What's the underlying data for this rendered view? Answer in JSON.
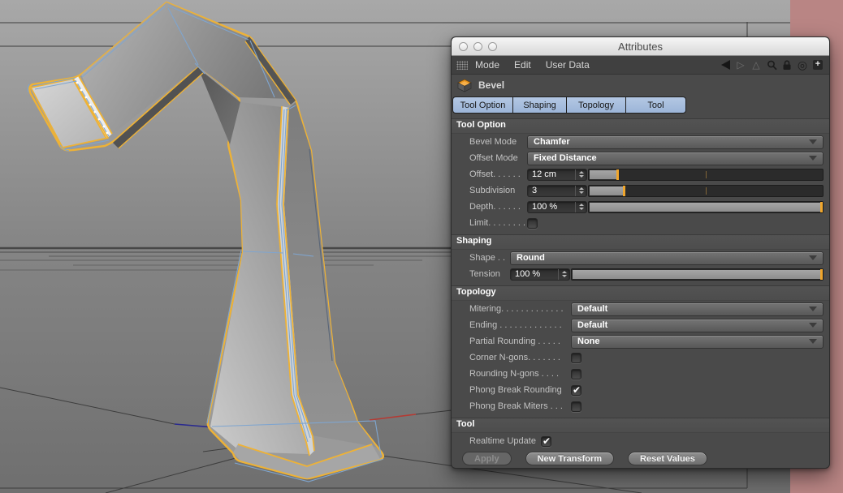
{
  "window": {
    "title": "Attributes"
  },
  "menubar": {
    "items": [
      "Mode",
      "Edit",
      "User Data"
    ],
    "plus_glyph": "+"
  },
  "object_header": {
    "label": "Bevel"
  },
  "tabs": [
    {
      "label": "Tool Option"
    },
    {
      "label": "Shaping"
    },
    {
      "label": "Topology"
    },
    {
      "label": "Tool"
    }
  ],
  "tool_option": {
    "title": "Tool Option",
    "bevel_mode": {
      "label": "Bevel Mode",
      "value": "Chamfer"
    },
    "offset_mode": {
      "label": "Offset Mode",
      "value": "Fixed Distance"
    },
    "offset": {
      "label": "Offset. . . . . .",
      "value": "12 cm",
      "slider_pct": 12
    },
    "subdivision": {
      "label": "Subdivision",
      "value": "3",
      "slider_pct": 15
    },
    "depth": {
      "label": "Depth. . . . . .",
      "value": "100 %",
      "slider_pct": 100
    },
    "limit": {
      "label": "Limit. . . . . . . .",
      "checked": false
    }
  },
  "shaping": {
    "title": "Shaping",
    "shape": {
      "label": "Shape . .",
      "value": "Round"
    },
    "tension": {
      "label": "Tension",
      "value": "100 %",
      "slider_pct": 100
    }
  },
  "topology": {
    "title": "Topology",
    "mitering": {
      "label": "Mitering. . . . . . . . . . . . .",
      "value": "Default"
    },
    "ending": {
      "label": "Ending . . . . . . . . . . . . .",
      "value": "Default"
    },
    "partial_rounding": {
      "label": "Partial Rounding . . . . .",
      "value": "None"
    },
    "corner_ngons": {
      "label": "Corner N-gons. . . . . . .",
      "checked": false
    },
    "rounding_ngons": {
      "label": "Rounding N-gons . . . .",
      "checked": false
    },
    "phong_break_rounding": {
      "label": "Phong Break Rounding",
      "checked": true
    },
    "phong_break_miters": {
      "label": "Phong Break Miters . . .",
      "checked": false
    }
  },
  "tool": {
    "title": "Tool",
    "realtime_update": {
      "label": "Realtime Update",
      "checked": true
    },
    "buttons": {
      "apply": "Apply",
      "new_transform": "New Transform",
      "reset_values": "Reset Values"
    }
  },
  "colors": {
    "selection_yellow": "#f0b43c",
    "wire_blue": "#7fa5cf",
    "accent_orange": "#e8941e",
    "tab_blue": "#a3bbdc",
    "right_band_red": "#b98584"
  }
}
